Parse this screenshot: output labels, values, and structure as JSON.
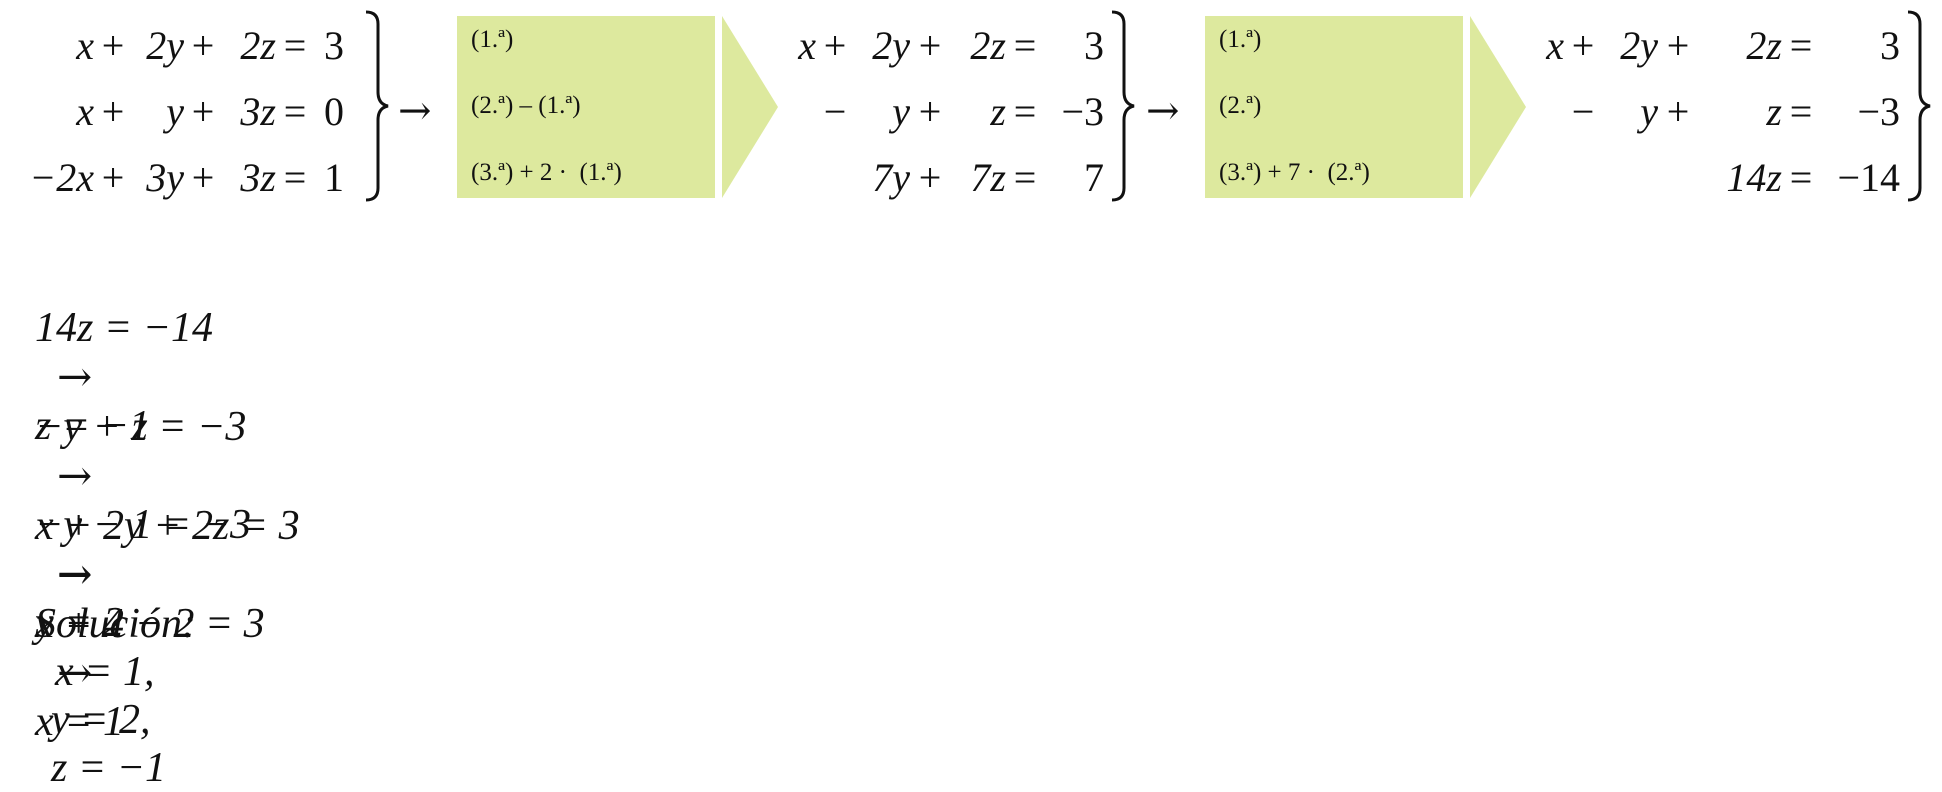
{
  "system1": {
    "rows": [
      [
        "x",
        "+",
        "2y",
        "+",
        "2z",
        "=",
        "3"
      ],
      [
        "x",
        "+",
        "y",
        "+",
        "3z",
        "=",
        "0"
      ],
      [
        "−2x",
        "+",
        "3y",
        "+",
        "3z",
        "=",
        "1"
      ]
    ]
  },
  "ops1": [
    "(1.ª)",
    "(2.ª) – (1.ª)",
    "(3.ª) + 2 ·  (1.ª)"
  ],
  "system2": {
    "rows": [
      [
        "x",
        "+",
        "2y",
        "+",
        "2z",
        "=",
        "3"
      ],
      [
        "",
        "−",
        "y",
        "+",
        "z",
        "=",
        "−3"
      ],
      [
        "",
        "",
        "7y",
        "+",
        "7z",
        "=",
        "7"
      ]
    ]
  },
  "ops2": [
    "(1.ª)",
    "(2.ª)",
    "(3.ª) + 7 ·  (2.ª)"
  ],
  "system3": {
    "rows": [
      [
        "x",
        "+",
        "2y",
        "+",
        "2z",
        "=",
        "3"
      ],
      [
        "",
        "−",
        "y",
        "+",
        "z",
        "=",
        "−3"
      ],
      [
        "",
        "",
        "",
        "",
        "14z",
        "=",
        "−14"
      ]
    ]
  },
  "arrow": "→",
  "steps": {
    "s1": {
      "a": "14z = −14",
      "b": "z = −1"
    },
    "s2": {
      "a": "−y + z = −3",
      "b": "−y − 1 = −3",
      "c": "y = 2"
    },
    "s3": {
      "a": "x + 2y + 2z = 3",
      "b": "x + 4 − 2 = 3",
      "c": "x = 1"
    },
    "solution": {
      "label": "Solución:",
      "x": "x = 1,",
      "y": "y = 2,",
      "z": "z = −1"
    }
  }
}
